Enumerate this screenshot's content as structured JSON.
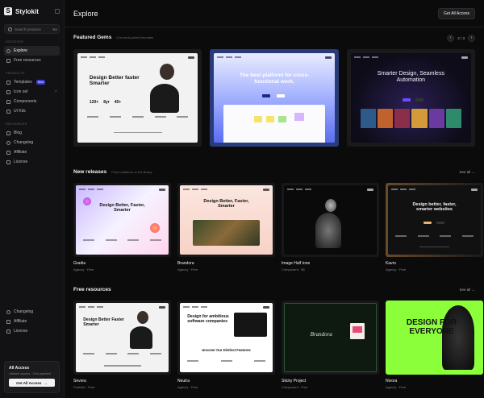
{
  "app": {
    "name": "Stylokit"
  },
  "sidebar": {
    "search": {
      "placeholder": "Search products",
      "shortcut": "⌘K"
    },
    "discover_label": "DISCOVER",
    "discover": [
      {
        "label": "Explore",
        "icon": "compass-icon"
      },
      {
        "label": "Free resources",
        "icon": "gift-icon"
      }
    ],
    "products_label": "PRODUCTS",
    "products": [
      {
        "label": "Templates",
        "icon": "template-icon",
        "badge": "New"
      },
      {
        "label": "Icon set",
        "icon": "grid-icon"
      },
      {
        "label": "Components",
        "icon": "components-icon"
      },
      {
        "label": "UI Kits",
        "icon": "layers-icon"
      }
    ],
    "resources_label": "RESOURCES",
    "resources": [
      {
        "label": "Blog",
        "icon": "blog-icon"
      },
      {
        "label": "Changelog",
        "icon": "changelog-icon"
      },
      {
        "label": "Affiliate",
        "icon": "affiliate-icon"
      },
      {
        "label": "License",
        "icon": "license-icon"
      }
    ],
    "bottom": [
      {
        "label": "Changelog",
        "icon": "changelog-icon"
      },
      {
        "label": "Affiliate",
        "icon": "affiliate-icon"
      },
      {
        "label": "License",
        "icon": "license-icon"
      }
    ],
    "access_card": {
      "title": "All Access",
      "subtitle": "Lifetime access · One payment",
      "button": "Get All Access",
      "button_icon": "arrow-right-icon"
    }
  },
  "header": {
    "title": "Explore",
    "cta": "Get All Access"
  },
  "featured": {
    "title": "Featured Gems",
    "subtitle": "Our hand-picked favorites",
    "pager": "2 / 3",
    "items": [
      {
        "headline": "Design Better faster Smarter",
        "stats": [
          "120+",
          "8yr",
          "45+"
        ]
      },
      {
        "headline": "The best platform for cross-functional work."
      },
      {
        "headline": "Smarter Design, Seamless Automation"
      }
    ]
  },
  "new_releases": {
    "title": "New releases",
    "subtitle": "Fresh additions to the library",
    "see_all": "See all",
    "items": [
      {
        "name": "Gradia",
        "meta": "Agency · Free",
        "headline": "Design Better, Faster, Smarter"
      },
      {
        "name": "Brandora",
        "meta": "Agency · Free",
        "headline": "Design Better, Faster, Smarter"
      },
      {
        "name": "Image Half tone",
        "meta": "Component · $5"
      },
      {
        "name": "Kavro",
        "meta": "Agency · Free",
        "headline": "Design better, faster, smarter websites"
      }
    ]
  },
  "free_resources": {
    "title": "Free resources",
    "see_all": "See all",
    "items": [
      {
        "name": "Sevora",
        "meta": "Portfolio · Free",
        "headline": "Design Better Faster Smarter"
      },
      {
        "name": "Neutra",
        "meta": "Agency · Free",
        "headline": "Design for ambitious software companies",
        "sub": "Uncover Our Distinct Features"
      },
      {
        "name": "Sticky Project",
        "meta": "Component · Free",
        "headline": "Brandora"
      },
      {
        "name": "Nivora",
        "meta": "Agency · Free",
        "headline": "DESIGN FOR EVERYONE"
      }
    ]
  },
  "colors": {
    "background": "#0b0b0c",
    "sidebar": "#121214",
    "accent": "#3b3bd1",
    "lime": "#8bff3a"
  }
}
